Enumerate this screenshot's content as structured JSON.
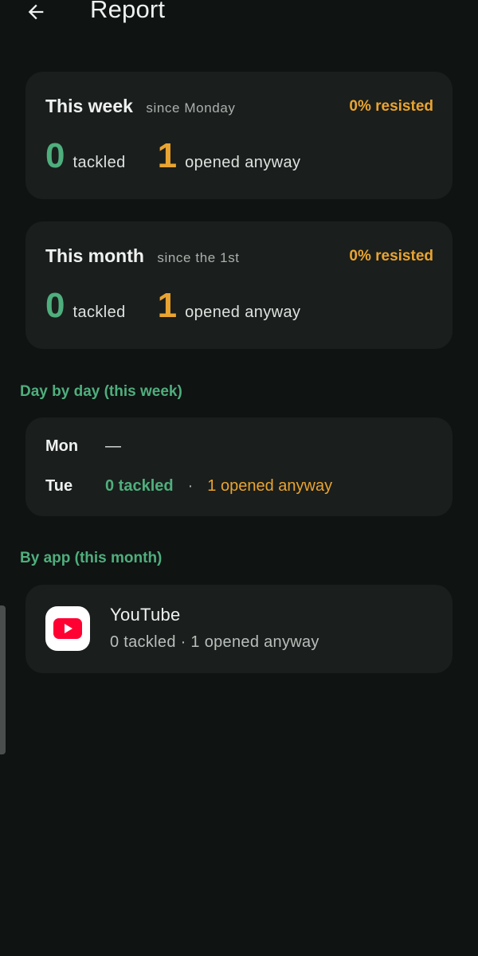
{
  "header": {
    "back_icon": "arrow-left-icon",
    "title": "Report"
  },
  "week_card": {
    "title": "This week",
    "subtitle": "since Monday",
    "resisted": "0% resisted",
    "tackled_count": "0",
    "tackled_label": "tackled",
    "opened_count": "1",
    "opened_label": "opened anyway"
  },
  "month_card": {
    "title": "This month",
    "subtitle": "since the 1st",
    "resisted": "0% resisted",
    "tackled_count": "0",
    "tackled_label": "tackled",
    "opened_count": "1",
    "opened_label": "opened anyway"
  },
  "day_by_day": {
    "section_title": "Day by day (this week)",
    "days": [
      {
        "name": "Mon",
        "value": "—"
      },
      {
        "name": "Tue",
        "tackled": "0 tackled",
        "separator": "·",
        "opened": "1 opened anyway"
      }
    ]
  },
  "by_app": {
    "section_title": "By app (this month)",
    "apps": [
      {
        "name": "YouTube",
        "icon": "youtube-icon",
        "stats": "0 tackled · 1 opened anyway"
      }
    ]
  },
  "colors": {
    "background": "#0f1312",
    "card": "#1a1e1c",
    "accent_green": "#4fae7d",
    "accent_orange": "#e9a431",
    "youtube_red": "#ff0033"
  }
}
